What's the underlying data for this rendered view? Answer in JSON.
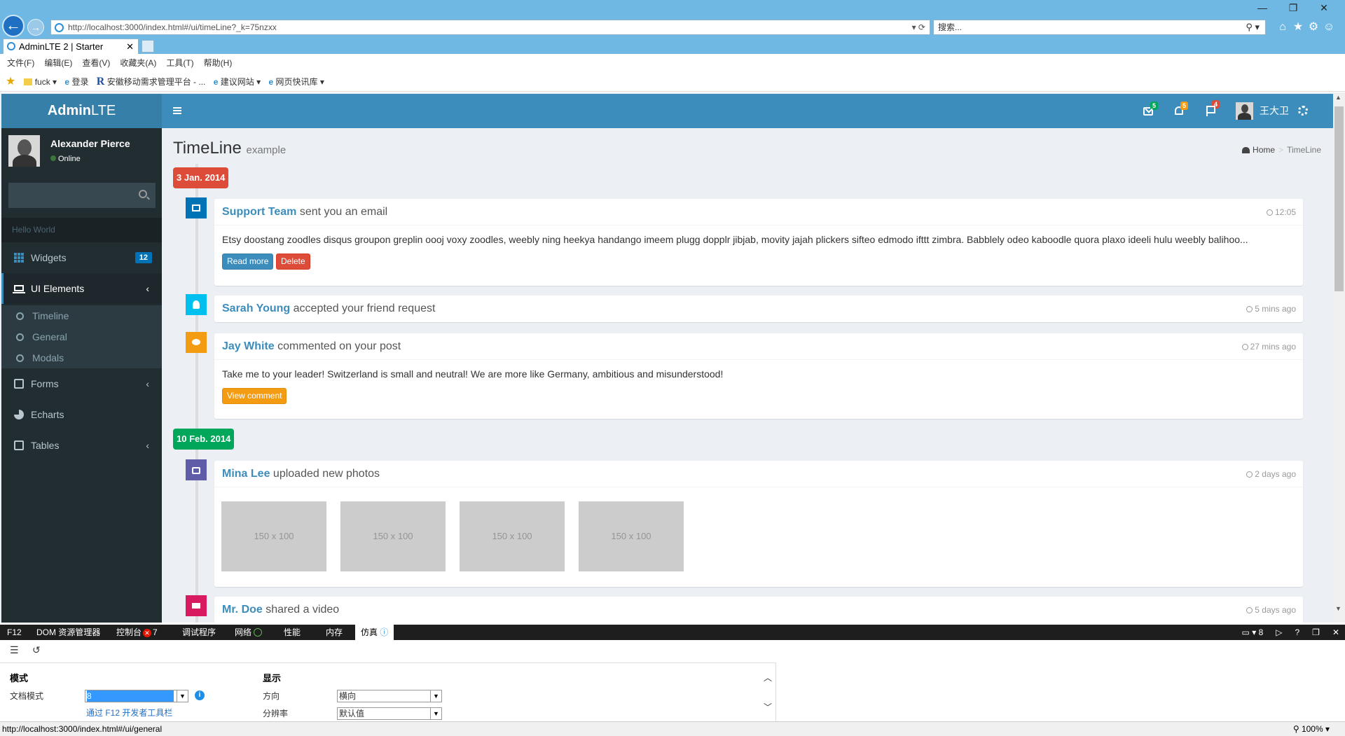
{
  "browser": {
    "url": "http://localhost:3000/index.html#/ui/timeLine?_k=75nzxx",
    "search_placeholder": "搜索...",
    "tab_title": "AdminLTE 2 | Starter",
    "menu": [
      "文件(F)",
      "编辑(E)",
      "查看(V)",
      "收藏夹(A)",
      "工具(T)",
      "帮助(H)"
    ],
    "favorites": [
      "fuck",
      "登录",
      "安徽移动需求管理平台 - ...",
      "建议网站",
      "网页快讯库"
    ],
    "status_url": "http://localhost:3000/index.html#/ui/general",
    "zoom": "100%"
  },
  "app": {
    "logo_bold": "Admin",
    "logo_rest": "LTE",
    "user_name": "Alexander Pierce",
    "user_status": "Online",
    "sidebar_header": "Hello World",
    "sidebar": {
      "widgets": "Widgets",
      "widgets_badge": "12",
      "ui_elements": "UI Elements",
      "sub_timeline": "Timeline",
      "sub_general": "General",
      "sub_modals": "Modals",
      "forms": "Forms",
      "echarts": "Echarts",
      "tables": "Tables"
    },
    "navbar": {
      "messages_count": "5",
      "notifications_count": "5",
      "tasks_count": "4",
      "user": "王大卫"
    },
    "page_title": "TimeLine",
    "page_subtitle": "example",
    "breadcrumb_home": "Home",
    "breadcrumb_current": "TimeLine"
  },
  "timeline": {
    "label1": "3 Jan. 2014",
    "label2": "10 Feb. 2014",
    "item1": {
      "who": "Support Team",
      "action": " sent you an email",
      "time": "12:05",
      "body": "Etsy doostang zoodles disqus groupon greplin oooj voxy zoodles, weebly ning heekya handango imeem plugg dopplr jibjab, movity jajah plickers sifteo edmodo ifttt zimbra. Babblely odeo kaboodle quora plaxo ideeli hulu weebly balihoo...",
      "btn1": "Read more",
      "btn2": "Delete"
    },
    "item2": {
      "who": "Sarah Young",
      "action": " accepted your friend request",
      "time": "5 mins ago"
    },
    "item3": {
      "who": "Jay White",
      "action": " commented on your post",
      "time": "27 mins ago",
      "body": "Take me to your leader! Switzerland is small and neutral! We are more like Germany, ambitious and misunderstood!",
      "btn": "View comment"
    },
    "item4": {
      "who": "Mina Lee",
      "action": " uploaded new photos",
      "time": "2 days ago",
      "photos": [
        "150 x 100",
        "150 x 100",
        "150 x 100",
        "150 x 100"
      ]
    },
    "item5": {
      "who": "Mr. Doe",
      "action": " shared a video",
      "time": "5 days ago"
    }
  },
  "devtools": {
    "tabs": [
      "F12",
      "DOM 资源管理器",
      "控制台",
      "调试程序",
      "网络",
      "性能",
      "内存",
      "仿真"
    ],
    "error_count": "7",
    "doc_mode_count": "8",
    "mode_title": "模式",
    "doc_mode_label": "文档模式",
    "doc_mode_value": "8",
    "doc_mode_link": "通过 F12 开发者工具栏",
    "display_title": "显示",
    "orientation_label": "方向",
    "orientation_value": "横向",
    "resolution_label": "分辨率",
    "resolution_value": "默认值"
  },
  "colors": {
    "accent": "#3c8dbc",
    "danger": "#dd4b39",
    "success": "#00a65a",
    "warning": "#f39c12",
    "aqua": "#00c0ef",
    "purple": "#605ca8",
    "maroon": "#d81b60",
    "blue": "#0073b7"
  }
}
